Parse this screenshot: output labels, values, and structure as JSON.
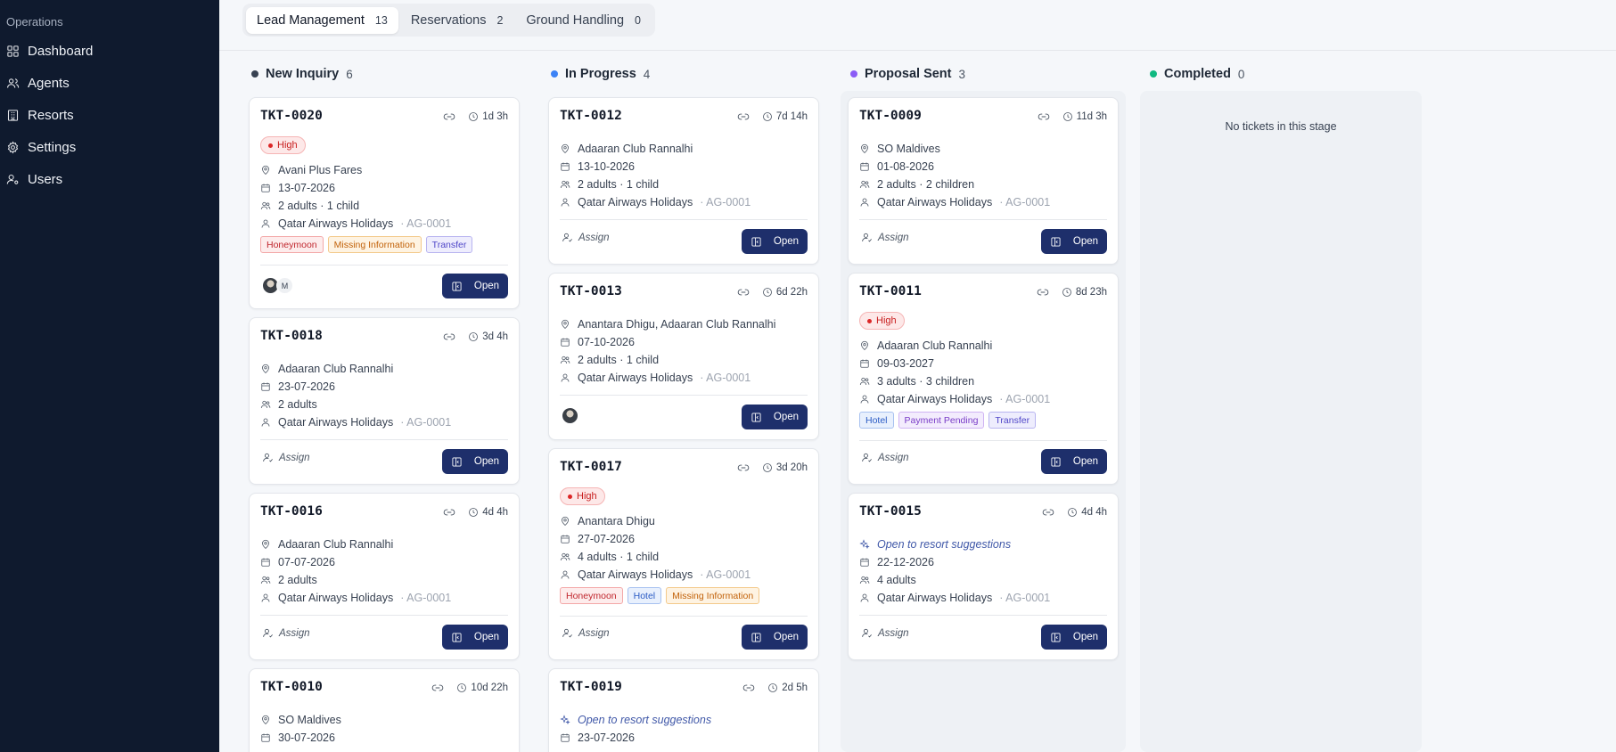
{
  "sidebar": {
    "section_label": "Operations",
    "items": [
      {
        "label": "Dashboard",
        "icon": "grid-icon"
      },
      {
        "label": "Agents",
        "icon": "users-icon"
      },
      {
        "label": "Resorts",
        "icon": "building-icon"
      },
      {
        "label": "Settings",
        "icon": "gear-icon"
      },
      {
        "label": "Users",
        "icon": "user-cog-icon"
      }
    ]
  },
  "tabs": [
    {
      "label": "Lead Management",
      "count": "13",
      "active": true
    },
    {
      "label": "Reservations",
      "count": "2"
    },
    {
      "label": "Ground Handling",
      "count": "0"
    }
  ],
  "columns": [
    {
      "title": "New Inquiry",
      "count": "6",
      "dot_color": "#374151"
    },
    {
      "title": "In Progress",
      "count": "4",
      "dot_color": "#3b82f6"
    },
    {
      "title": "Proposal Sent",
      "count": "3",
      "dot_color": "#8b5cf6"
    },
    {
      "title": "Completed",
      "count": "0",
      "dot_color": "#10b981",
      "empty_text": "No tickets in this stage"
    }
  ],
  "common": {
    "open_label": "Open",
    "assign_label": "Assign",
    "priority_high": "High",
    "agent_name": "Qatar Airways Holidays",
    "agent_code": "· AG-0001",
    "avatar_initial": "M"
  },
  "cards": {
    "tkt0020": {
      "id": "TKT-0020",
      "age": "1d 3h",
      "resort": "Avani Plus Fares",
      "date": "13-07-2026",
      "guests": "2 adults · 1 child",
      "tags": [
        "Honeymoon",
        "Missing Information",
        "Transfer"
      ]
    },
    "tkt0018": {
      "id": "TKT-0018",
      "age": "3d 4h",
      "resort": "Adaaran Club Rannalhi",
      "date": "23-07-2026",
      "guests": "2 adults"
    },
    "tkt0016": {
      "id": "TKT-0016",
      "age": "4d 4h",
      "resort": "Adaaran Club Rannalhi",
      "date": "07-07-2026",
      "guests": "2 adults"
    },
    "tkt0010": {
      "id": "TKT-0010",
      "age": "10d 22h",
      "resort": "SO Maldives",
      "date": "30-07-2026"
    },
    "tkt0012": {
      "id": "TKT-0012",
      "age": "7d 14h",
      "resort": "Adaaran Club Rannalhi",
      "date": "13-10-2026",
      "guests": "2 adults · 1 child"
    },
    "tkt0013": {
      "id": "TKT-0013",
      "age": "6d 22h",
      "resort": "Anantara Dhigu, Adaaran Club Rannalhi",
      "date": "07-10-2026",
      "guests": "2 adults · 1 child"
    },
    "tkt0017": {
      "id": "TKT-0017",
      "age": "3d 20h",
      "resort": "Anantara Dhigu",
      "date": "27-07-2026",
      "guests": "4 adults · 1 child",
      "tags": [
        "Honeymoon",
        "Hotel",
        "Missing Information"
      ]
    },
    "tkt0019": {
      "id": "TKT-0019",
      "age": "2d 5h",
      "resort": "Open to resort suggestions",
      "date": "23-07-2026"
    },
    "tkt0009": {
      "id": "TKT-0009",
      "age": "11d 3h",
      "resort": "SO Maldives",
      "date": "01-08-2026",
      "guests": "2 adults · 2 children"
    },
    "tkt0011": {
      "id": "TKT-0011",
      "age": "8d 23h",
      "resort": "Adaaran Club Rannalhi",
      "date": "09-03-2027",
      "guests": "3 adults · 3 children",
      "tags": [
        "Hotel",
        "Payment Pending",
        "Transfer"
      ]
    },
    "tkt0015": {
      "id": "TKT-0015",
      "age": "4d 4h",
      "resort": "Open to resort suggestions",
      "date": "22-12-2026",
      "guests": "4 adults"
    }
  }
}
